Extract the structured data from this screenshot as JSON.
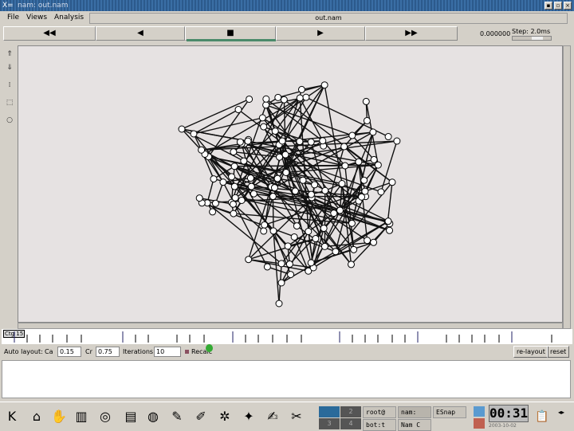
{
  "window": {
    "title": "nam: out.nam",
    "filename": "out.nam"
  },
  "menu": [
    "File",
    "Views",
    "Analysis"
  ],
  "controls": {
    "rewind": "◀◀",
    "back": "◀",
    "stop": "■",
    "play": "▶",
    "fastforward": "▶▶",
    "time": "0.000000",
    "step": "Step: 2.0ms"
  },
  "tools": [
    "zoom-in",
    "zoom-out",
    "edit",
    "select",
    "node"
  ],
  "timeline": {
    "label": "Ctg 15"
  },
  "autolayout": {
    "label": "Auto layout:",
    "ca_label": "Ca",
    "ca_value": "0.15",
    "cr_label": "Cr",
    "cr_value": "0.75",
    "iter_label": "Iterations",
    "iter_value": "10",
    "recalc_label": "Recalc",
    "relayout": "re-layout",
    "reset": "reset"
  },
  "graph": {
    "node_count": 110,
    "edge_count": 230
  },
  "taskbar": {
    "desktops": [
      "1",
      "2",
      "3",
      "4"
    ],
    "tasks": [
      "root@",
      "nam:",
      "ESnap",
      "bot:t",
      "Nam C"
    ],
    "clock": "00:31",
    "date": "2003-10-02"
  }
}
